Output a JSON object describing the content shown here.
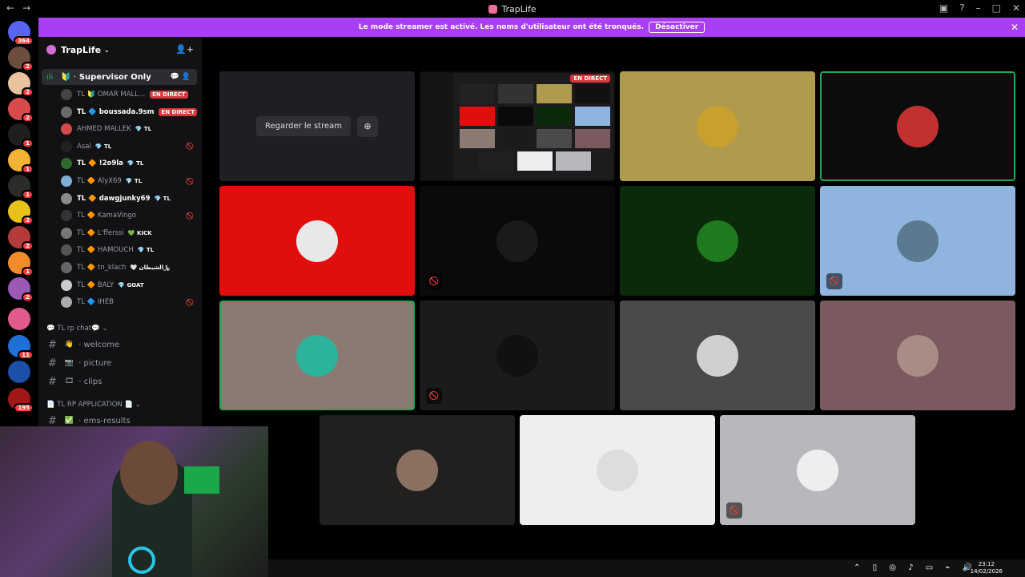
{
  "window": {
    "title": "TrapLife",
    "nav_back": "←",
    "nav_forward": "→"
  },
  "banner": {
    "text": "Le mode streamer est activé. Les noms d'utilisateur ont été tronqués.",
    "button": "Désactiver",
    "close": "✕"
  },
  "guilds": [
    {
      "color": "#5865f2",
      "badge": "364"
    },
    {
      "color": "#6b4e3d",
      "badge": "2"
    },
    {
      "color": "#e8c39e",
      "badge": "2"
    },
    {
      "color": "#d84a4a",
      "badge": "2"
    },
    {
      "color": "#1e1e1e",
      "badge": "1"
    },
    {
      "color": "#f2b233",
      "badge": "1"
    },
    {
      "color": "#2b2b2b",
      "badge": "1"
    },
    {
      "color": "#e8c21a",
      "badge": "2"
    },
    {
      "color": "#b53a3a",
      "badge": "2"
    },
    {
      "color": "#f28c2b",
      "badge": "1"
    },
    {
      "color": "#9b59b6",
      "badge": "2"
    },
    {
      "color": "#e05a8b",
      "badge": ""
    },
    {
      "color": "#1f6fd6",
      "badge": "11"
    },
    {
      "color": "#1b4fa8",
      "badge": ""
    },
    {
      "color": "#a01818",
      "badge": "195"
    }
  ],
  "server": {
    "name": "TrapLife",
    "chevron": "⌄"
  },
  "voice_channel": {
    "name": "Supervisor Only",
    "prefix": "🔰 ·"
  },
  "members": [
    {
      "name": "TL 🔰 OMAR MALL...",
      "tag": "",
      "live": "EN DIRECT",
      "bright": false,
      "color": "#444"
    },
    {
      "name": "TL 🔷 boussada.9sm",
      "tag": "",
      "live": "EN DIRECT",
      "bright": true,
      "color": "#6a6a6a"
    },
    {
      "name": "AHMED MALLEK",
      "tag": "💎 TL",
      "live": "",
      "bright": false,
      "color": "#d84a4a"
    },
    {
      "name": "Asal",
      "tag": "💎 TL",
      "live": "",
      "bright": false,
      "color": "#222",
      "muted": true
    },
    {
      "name": "TL 🔶 !2o9la",
      "tag": "💎 TL",
      "live": "",
      "bright": true,
      "color": "#2d6b2d"
    },
    {
      "name": "TL 🔶 AlyX69",
      "tag": "💎 TL",
      "live": "",
      "bright": false,
      "color": "#7fb0d8",
      "muted": true
    },
    {
      "name": "TL 🔶 dawgjunky69",
      "tag": "💎 TL",
      "live": "",
      "bright": true,
      "color": "#8a8a8a"
    },
    {
      "name": "TL 🔶 KamaVingo",
      "tag": "",
      "live": "",
      "bright": false,
      "color": "#333",
      "muted": true
    },
    {
      "name": "TL 🔶 L'fferssi",
      "tag": "💚 KICK",
      "live": "",
      "bright": false,
      "color": "#777"
    },
    {
      "name": "TL 🔶 HAMOUCH",
      "tag": "💎 TL",
      "live": "",
      "bright": false,
      "color": "#555"
    },
    {
      "name": "TL 🔶 tn_klach",
      "tag": "🤍 ﷼الشيطان",
      "live": "",
      "bright": false,
      "color": "#666"
    },
    {
      "name": "TL 🔶 BALY",
      "tag": "💎 GOAT",
      "live": "",
      "bright": false,
      "color": "#ccc"
    },
    {
      "name": "TL 🔷 IHEB",
      "tag": "",
      "live": "",
      "bright": false,
      "color": "#aaa",
      "muted": true
    }
  ],
  "categories": [
    {
      "label": "💬 TL rp chat💬 ⌄"
    },
    {
      "label": "📄 TL RP APPLICATION 📄 ⌄"
    }
  ],
  "channels": [
    {
      "emoji": "👋",
      "name": "· welcome"
    },
    {
      "emoji": "📷",
      "name": "· picture"
    },
    {
      "emoji": "🎞",
      "name": "· clips"
    },
    {
      "emoji": "✅",
      "name": "· ems-results"
    }
  ],
  "stream_tile": {
    "watch_label": "Regarder le stream",
    "watch_icon": "⊕"
  },
  "screen_share": {
    "live_label": "EN DIRECT"
  },
  "tiles": [
    {
      "bg": "#b09a4e",
      "av": "#c8a030",
      "speaking": false,
      "icon": ""
    },
    {
      "bg": "#0c0c0c",
      "av": "#c23030",
      "speaking": true,
      "icon": ""
    },
    {
      "bg": "#e10e0e",
      "av": "#e8e8e8",
      "speaking": false,
      "icon": ""
    },
    {
      "bg": "#0a0a0a",
      "av": "#1a1a1a",
      "speaking": false,
      "icon": "🚫"
    },
    {
      "bg": "#0b2a0b",
      "av": "#1f7a1f",
      "speaking": false,
      "icon": ""
    },
    {
      "bg": "#8fb5df",
      "av": "#5a7a90",
      "speaking": false,
      "icon": "🚫"
    },
    {
      "bg": "#8a7a72",
      "av": "#2db39c",
      "speaking": true,
      "icon": ""
    },
    {
      "bg": "#1b1b1b",
      "av": "#111",
      "speaking": false,
      "icon": "🚫"
    },
    {
      "bg": "#4a4a4a",
      "av": "#d0d0d0",
      "speaking": false,
      "icon": ""
    },
    {
      "bg": "#7a5a5e",
      "av": "#a88c86",
      "speaking": false,
      "icon": ""
    },
    {
      "bg": "#22201e",
      "av": "#8a7060",
      "speaking": false,
      "icon": ""
    },
    {
      "bg": "#eeeeee",
      "av": "#dddddd",
      "speaking": false,
      "icon": ""
    },
    {
      "bg": "#b8b8bc",
      "av": "#eeeeee",
      "speaking": false,
      "icon": "🚫"
    }
  ],
  "taskbar": {
    "time": "23:12",
    "date": "14/02/2026",
    "tray": "⌃ ▯ ◎ ♪ ▭ ⌁ 🔊"
  }
}
